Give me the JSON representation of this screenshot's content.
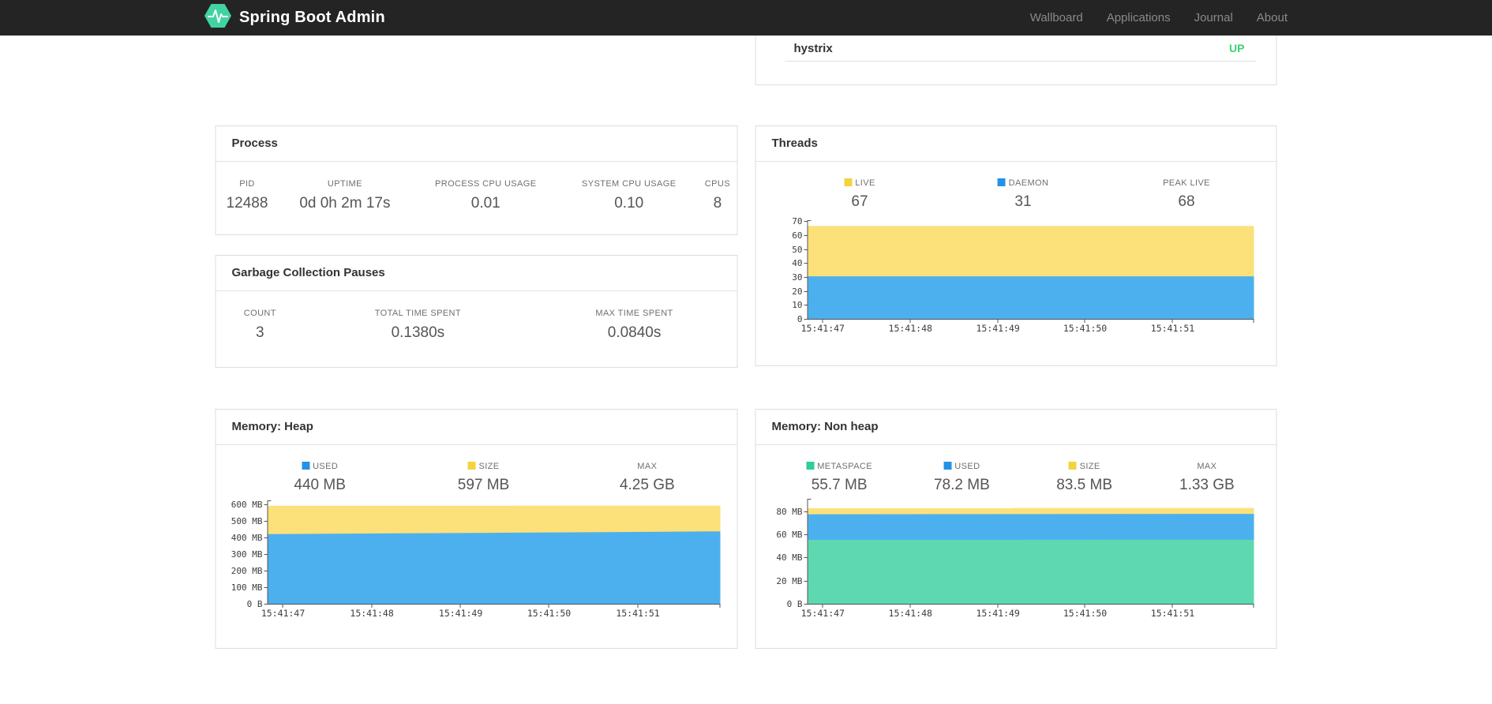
{
  "navbar": {
    "brand": "Spring Boot Admin",
    "brand_color": "#42d3a2",
    "items": [
      {
        "label": "Wallboard"
      },
      {
        "label": "Applications"
      },
      {
        "label": "Journal"
      },
      {
        "label": "About"
      }
    ]
  },
  "health_card": {
    "row_label": "hystrix",
    "row_status": "UP",
    "status_color": "#38d273"
  },
  "process_card": {
    "title": "Process",
    "stats": [
      {
        "label": "PID",
        "value": "12488"
      },
      {
        "label": "UPTIME",
        "value": "0d 0h 2m 17s"
      },
      {
        "label": "PROCESS CPU USAGE",
        "value": "0.01"
      },
      {
        "label": "SYSTEM CPU USAGE",
        "value": "0.10"
      },
      {
        "label": "CPUS",
        "value": "8"
      }
    ]
  },
  "gc_card": {
    "title": "Garbage Collection Pauses",
    "stats": [
      {
        "label": "COUNT",
        "value": "3"
      },
      {
        "label": "TOTAL TIME SPENT",
        "value": "0.1380s"
      },
      {
        "label": "MAX TIME SPENT",
        "value": "0.0840s"
      }
    ]
  },
  "threads_card": {
    "title": "Threads",
    "stats": [
      {
        "label": "LIVE",
        "value": "67",
        "color": "#f3d43f"
      },
      {
        "label": "DAEMON",
        "value": "31",
        "color": "#2492e8"
      },
      {
        "label": "PEAK LIVE",
        "value": "68"
      }
    ]
  },
  "heap_card": {
    "title": "Memory: Heap",
    "stats": [
      {
        "label": "USED",
        "value": "440 MB",
        "color": "#2492e8"
      },
      {
        "label": "SIZE",
        "value": "597 MB",
        "color": "#f3d43f"
      },
      {
        "label": "MAX",
        "value": "4.25 GB"
      }
    ]
  },
  "nonheap_card": {
    "title": "Memory: Non heap",
    "stats": [
      {
        "label": "METASPACE",
        "value": "55.7 MB",
        "color": "#2fcd9a"
      },
      {
        "label": "USED",
        "value": "78.2 MB",
        "color": "#2492e8"
      },
      {
        "label": "SIZE",
        "value": "83.5 MB",
        "color": "#f3d43f"
      },
      {
        "label": "MAX",
        "value": "1.33 GB"
      }
    ]
  },
  "chart_data": {
    "threads": {
      "type": "area",
      "title": "Threads",
      "grid": false,
      "legend_position": "top",
      "xlabel": "",
      "ylabel": "",
      "ylim": [
        0,
        71.2
      ],
      "yticks": [
        {
          "v": 0,
          "label": "0"
        },
        {
          "v": 10,
          "label": "10"
        },
        {
          "v": 20,
          "label": "20"
        },
        {
          "v": 30,
          "label": "30"
        },
        {
          "v": 40,
          "label": "40"
        },
        {
          "v": 50,
          "label": "50"
        },
        {
          "v": 60,
          "label": "60"
        },
        {
          "v": 70,
          "label": "70"
        }
      ],
      "xticks": [
        {
          "frac": 0.035,
          "label": "15:41:47"
        },
        {
          "frac": 0.231,
          "label": "15:41:48"
        },
        {
          "frac": 0.427,
          "label": "15:41:49"
        },
        {
          "frac": 0.622,
          "label": "15:41:50"
        },
        {
          "frac": 0.818,
          "label": "15:41:51"
        },
        {
          "frac": 1,
          "label": ""
        }
      ],
      "series": [
        {
          "name": "LIVE",
          "color": "#fce07a",
          "points": [
            [
              0,
              67
            ],
            [
              1,
              67
            ]
          ]
        },
        {
          "name": "DAEMON",
          "color": "#4db0ee",
          "points": [
            [
              0,
              31
            ],
            [
              1,
              31
            ]
          ]
        }
      ]
    },
    "heap": {
      "type": "area",
      "title": "Memory: Heap",
      "grid": false,
      "legend_position": "top",
      "xlabel": "",
      "ylabel": "",
      "ylim": [
        0,
        628.6
      ],
      "yticks": [
        {
          "v": 0,
          "label": "0 B"
        },
        {
          "v": 100,
          "label": "100 MB"
        },
        {
          "v": 200,
          "label": "200 MB"
        },
        {
          "v": 300,
          "label": "300 MB"
        },
        {
          "v": 400,
          "label": "400 MB"
        },
        {
          "v": 500,
          "label": "500 MB"
        },
        {
          "v": 600,
          "label": "600 MB"
        }
      ],
      "xticks": [
        {
          "frac": 0.035,
          "label": "15:41:47"
        },
        {
          "frac": 0.231,
          "label": "15:41:48"
        },
        {
          "frac": 0.427,
          "label": "15:41:49"
        },
        {
          "frac": 0.622,
          "label": "15:41:50"
        },
        {
          "frac": 0.818,
          "label": "15:41:51"
        },
        {
          "frac": 1,
          "label": ""
        }
      ],
      "series": [
        {
          "name": "SIZE",
          "color": "#fce07a",
          "points": [
            [
              0,
              596
            ],
            [
              0.5,
              596.5
            ],
            [
              1,
              597
            ]
          ]
        },
        {
          "name": "USED",
          "color": "#4db0ee",
          "points": [
            [
              0,
              425
            ],
            [
              0.25,
              429
            ],
            [
              0.5,
              433
            ],
            [
              0.75,
              437
            ],
            [
              1,
              442
            ]
          ]
        }
      ]
    },
    "nonheap": {
      "type": "area",
      "title": "Memory: Non heap",
      "grid": false,
      "legend_position": "top",
      "xlabel": "",
      "ylabel": "",
      "ylim": [
        0,
        91.4
      ],
      "yticks": [
        {
          "v": 0,
          "label": "0 B"
        },
        {
          "v": 20,
          "label": "20 MB"
        },
        {
          "v": 40,
          "label": "40 MB"
        },
        {
          "v": 60,
          "label": "60 MB"
        },
        {
          "v": 80,
          "label": "80 MB"
        }
      ],
      "xticks": [
        {
          "frac": 0.035,
          "label": "15:41:47"
        },
        {
          "frac": 0.231,
          "label": "15:41:48"
        },
        {
          "frac": 0.427,
          "label": "15:41:49"
        },
        {
          "frac": 0.622,
          "label": "15:41:50"
        },
        {
          "frac": 0.818,
          "label": "15:41:51"
        },
        {
          "frac": 1,
          "label": ""
        }
      ],
      "series": [
        {
          "name": "SIZE",
          "color": "#fce07a",
          "points": [
            [
              0,
              83.2
            ],
            [
              0.45,
              83.2
            ],
            [
              0.47,
              83.5
            ],
            [
              1,
              83.5
            ]
          ]
        },
        {
          "name": "USED",
          "color": "#4db0ee",
          "points": [
            [
              0,
              78.0
            ],
            [
              0.5,
              78.2
            ],
            [
              1,
              78.4
            ]
          ]
        },
        {
          "name": "METASPACE",
          "color": "#5ed8b0",
          "points": [
            [
              0,
              55.9
            ],
            [
              1,
              56.0
            ]
          ]
        }
      ]
    }
  }
}
